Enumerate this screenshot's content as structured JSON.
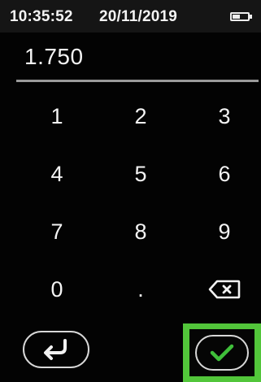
{
  "status_bar": {
    "time": "10:35:52",
    "date": "20/11/2019",
    "battery_icon": "battery-icon"
  },
  "display": {
    "value": "1.750"
  },
  "keypad": {
    "row1": [
      "1",
      "2",
      "3"
    ],
    "row2": [
      "4",
      "5",
      "6"
    ],
    "row3": [
      "7",
      "8",
      "9"
    ],
    "row4": [
      "0",
      "."
    ],
    "backspace_icon": "backspace-icon"
  },
  "controls": {
    "back_icon": "return-arrow-icon",
    "confirm_icon": "checkmark-icon"
  },
  "colors": {
    "background": "#030303",
    "status_bar": "#151515",
    "confirm_check": "#3fbf3a",
    "highlight_frame": "#52c63a"
  }
}
